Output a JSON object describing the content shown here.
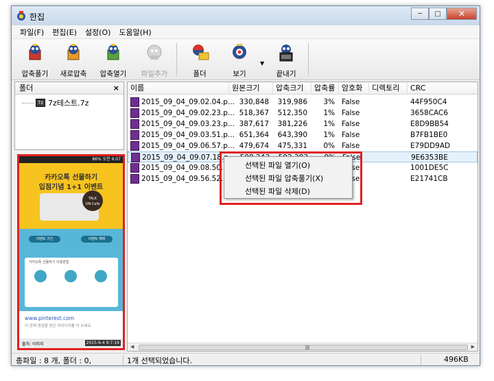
{
  "window": {
    "title": "한집",
    "controls": {
      "minimize": "─",
      "maximize": "□",
      "close": "✕"
    }
  },
  "menu": [
    "파일(F)",
    "편집(E)",
    "설정(O)",
    "도움말(H)"
  ],
  "toolbar": {
    "buttons": [
      {
        "label": "압축풀기",
        "icon": "extract-icon",
        "enabled": true
      },
      {
        "label": "새로압축",
        "icon": "new-archive-icon",
        "enabled": true
      },
      {
        "label": "압축열기",
        "icon": "open-archive-icon",
        "enabled": true
      },
      {
        "label": "파일추가",
        "icon": "add-file-icon",
        "enabled": false
      },
      {
        "label": "폴더",
        "icon": "folder-icon",
        "enabled": true
      },
      {
        "label": "보기",
        "icon": "view-icon",
        "enabled": true
      },
      {
        "label": "끝내기",
        "icon": "exit-icon",
        "enabled": true
      }
    ]
  },
  "folder_panel": {
    "title": "폴더",
    "close": "×",
    "tree": [
      {
        "label": "7z테스트.7z",
        "icon": "7z-archive-icon"
      }
    ]
  },
  "preview": {
    "status_time": "오전 9:07",
    "status_battery": "86%",
    "banner_line1": "카카오톡 선물하기",
    "banner_line2": "입점기념 1+1 이벤트",
    "bubble_line1": "TALK",
    "bubble_line2": "ON Café",
    "pill_left": "이벤트 기간",
    "pill_right": "이벤트 혜택",
    "card_title": "카카오톡 선물하기 이용방법",
    "url": "www.pinterest.com",
    "url_desc": "이 핀에 영감을 받은 아이디어를 더 보세요",
    "footer_left": "출처: 이미지",
    "timestamp": "2015-9-4 9:7:19"
  },
  "file_list": {
    "columns": [
      "이름",
      "원본크기",
      "압축크기",
      "압축률",
      "암호화",
      "디렉토리",
      "CRC"
    ],
    "rows": [
      {
        "name": "2015_09_04_09.02.04.p...",
        "original": "330,848",
        "compressed": "319,986",
        "ratio": "3%",
        "encrypted": "False",
        "dir": "",
        "crc": "44F950C4"
      },
      {
        "name": "2015_09_04_09.02.23.p...",
        "original": "518,367",
        "compressed": "512,350",
        "ratio": "1%",
        "encrypted": "False",
        "dir": "",
        "crc": "3658CAC6"
      },
      {
        "name": "2015_09_04_09.03.23.p...",
        "original": "387,617",
        "compressed": "381,226",
        "ratio": "1%",
        "encrypted": "False",
        "dir": "",
        "crc": "E8D9BB54"
      },
      {
        "name": "2015_09_04_09.03.51.p...",
        "original": "651,364",
        "compressed": "643,390",
        "ratio": "1%",
        "encrypted": "False",
        "dir": "",
        "crc": "B7FB1BE0"
      },
      {
        "name": "2015_09_04_09.06.57.p...",
        "original": "479,674",
        "compressed": "475,331",
        "ratio": "0%",
        "encrypted": "False",
        "dir": "",
        "crc": "E79DD9AD"
      },
      {
        "name": "2015_09_04_09.07.18.p...",
        "original": "508,243",
        "compressed": "502,383",
        "ratio": "0%",
        "encrypted": "False",
        "dir": "",
        "crc": "9E6353BE",
        "selected": true
      },
      {
        "name": "2015_09_04_09.08.50.p...",
        "original": "",
        "compressed": "",
        "ratio": "",
        "encrypted": "False",
        "dir": "",
        "crc": "1001DE5C"
      },
      {
        "name": "2015_09_04_09.56.52.p...",
        "original": "",
        "compressed": "",
        "ratio": "",
        "encrypted": "False",
        "dir": "",
        "crc": "E21741CB"
      }
    ]
  },
  "context_menu": [
    "선택된 파일 열기(O)",
    "선택된 파일 압축풀기(X)",
    "선택된 파일 삭제(D)"
  ],
  "status": {
    "totals": "총파일 : 8 개, 폴더 : 0,",
    "selection": "1개 선택되었습니다.",
    "size": "496KB"
  },
  "colors": {
    "highlight": "#e02020",
    "selected_row": "#e5f1fb",
    "file_icon": "#6f2f90"
  }
}
